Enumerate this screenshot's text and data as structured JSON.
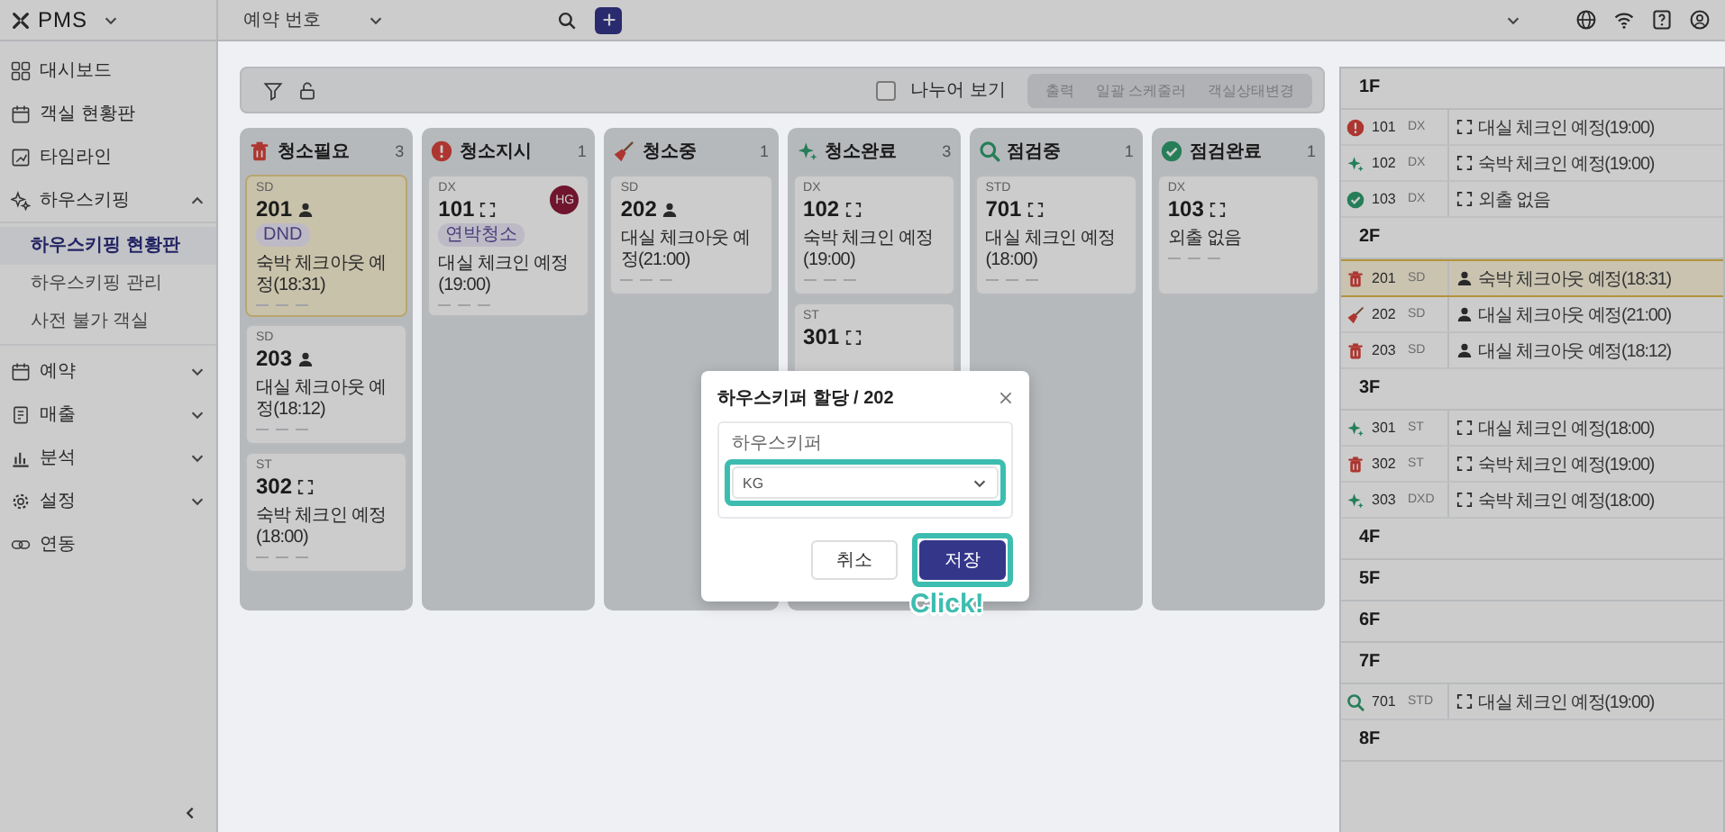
{
  "app": {
    "logo": "PMS"
  },
  "topbar": {
    "search_type": "예약 번호"
  },
  "sidebar": {
    "items": [
      {
        "label": "대시보드"
      },
      {
        "label": "객실 현황판"
      },
      {
        "label": "타임라인"
      },
      {
        "label": "하우스키핑",
        "expanded": true,
        "children": [
          {
            "label": "하우스키핑 현황판",
            "selected": true
          },
          {
            "label": "하우스키핑 관리",
            "selected": false
          },
          {
            "label": "사전 불가 객실",
            "selected": false
          }
        ]
      },
      {
        "label": "예약",
        "expanded": false
      },
      {
        "label": "매출",
        "expanded": false
      },
      {
        "label": "분석",
        "expanded": false
      },
      {
        "label": "설정",
        "expanded": false
      },
      {
        "label": "연동"
      }
    ]
  },
  "toolbar": {
    "split_view": {
      "label": "나누어 보기",
      "checked": false
    },
    "segments": [
      "출력",
      "일괄 스케줄러",
      "객실상태변경"
    ]
  },
  "columns": [
    {
      "title": "청소필요",
      "count": "3",
      "kind": "need",
      "cards": [
        {
          "type": "SD",
          "number": "201",
          "occupied": true,
          "badge": "DND",
          "note": "숙박 체크아웃 예정(18:31)",
          "highlighted": true
        },
        {
          "type": "SD",
          "number": "203",
          "occupied": true,
          "note": "대실 체크아웃 예정(18:12)",
          "highlighted": false
        },
        {
          "type": "ST",
          "number": "302",
          "occupied": false,
          "note": "숙박 체크인 예정(18:00)",
          "highlighted": false
        }
      ]
    },
    {
      "title": "청소지시",
      "count": "1",
      "kind": "order",
      "cards": [
        {
          "type": "DX",
          "number": "101",
          "occupied": false,
          "avatar": "HG",
          "badge": "연박청소",
          "note": "대실 체크인 예정(19:00)",
          "highlighted": false
        }
      ]
    },
    {
      "title": "청소중",
      "count": "1",
      "kind": "cleaning",
      "cards": [
        {
          "type": "SD",
          "number": "202",
          "occupied": true,
          "note": "대실 체크아웃 예정(21:00)",
          "highlighted": false
        }
      ]
    },
    {
      "title": "청소완료",
      "count": "3",
      "kind": "done",
      "cards": [
        {
          "type": "DX",
          "number": "102",
          "occupied": false,
          "note": "숙박 체크인 예정(19:00)",
          "highlighted": false
        },
        {
          "type": "ST",
          "number": "301",
          "occupied": false,
          "highlighted": false
        }
      ]
    },
    {
      "title": "점검중",
      "count": "1",
      "kind": "inspecting",
      "cards": [
        {
          "type": "STD",
          "number": "701",
          "occupied": false,
          "note": "대실 체크인 예정(18:00)",
          "highlighted": false
        }
      ]
    },
    {
      "title": "점검완료",
      "count": "1",
      "kind": "inspected",
      "cards": [
        {
          "type": "DX",
          "number": "103",
          "occupied": false,
          "note": "외출 없음",
          "highlighted": false
        }
      ]
    }
  ],
  "floors": [
    {
      "label": "1F",
      "rooms": [
        {
          "kind": "order",
          "number": "101",
          "type": "DX",
          "occupied": false,
          "note": "대실 체크인 예정(19:00)",
          "highlighted": false
        },
        {
          "kind": "done",
          "number": "102",
          "type": "DX",
          "occupied": false,
          "note": "숙박 체크인 예정(19:00)",
          "highlighted": false
        },
        {
          "kind": "inspected",
          "number": "103",
          "type": "DX",
          "occupied": false,
          "note": "외출 없음",
          "highlighted": false
        }
      ]
    },
    {
      "label": "2F",
      "rooms": [
        {
          "kind": "need",
          "number": "201",
          "type": "SD",
          "occupied": true,
          "note": "숙박 체크아웃 예정(18:31)",
          "highlighted": true
        },
        {
          "kind": "cleaning",
          "number": "202",
          "type": "SD",
          "occupied": true,
          "note": "대실 체크아웃 예정(21:00)",
          "highlighted": false
        },
        {
          "kind": "need",
          "number": "203",
          "type": "SD",
          "occupied": true,
          "note": "대실 체크아웃 예정(18:12)",
          "highlighted": false
        }
      ]
    },
    {
      "label": "3F",
      "rooms": [
        {
          "kind": "done",
          "number": "301",
          "type": "ST",
          "occupied": false,
          "note": "대실 체크인 예정(18:00)",
          "highlighted": false
        },
        {
          "kind": "need",
          "number": "302",
          "type": "ST",
          "occupied": false,
          "note": "숙박 체크인 예정(19:00)",
          "highlighted": false
        },
        {
          "kind": "done",
          "number": "303",
          "type": "DXD",
          "occupied": false,
          "note": "숙박 체크인 예정(18:00)",
          "highlighted": false
        }
      ]
    },
    {
      "label": "4F"
    },
    {
      "label": "5F"
    },
    {
      "label": "6F"
    },
    {
      "label": "7F",
      "rooms": [
        {
          "kind": "inspecting",
          "number": "701",
          "type": "STD",
          "occupied": false,
          "note": "대실 체크인 예정(19:00)",
          "highlighted": false
        }
      ]
    },
    {
      "label": "8F"
    }
  ],
  "modal": {
    "title": "하우스키퍼 할당 / 202",
    "field_label": "하우스키퍼",
    "value": "KG",
    "field_highlighted": true,
    "buttons": [
      {
        "label": "취소",
        "kind": "secondary",
        "highlighted": false
      },
      {
        "label": "저장",
        "kind": "primary",
        "highlighted": true
      }
    ],
    "callout": "Click!"
  }
}
